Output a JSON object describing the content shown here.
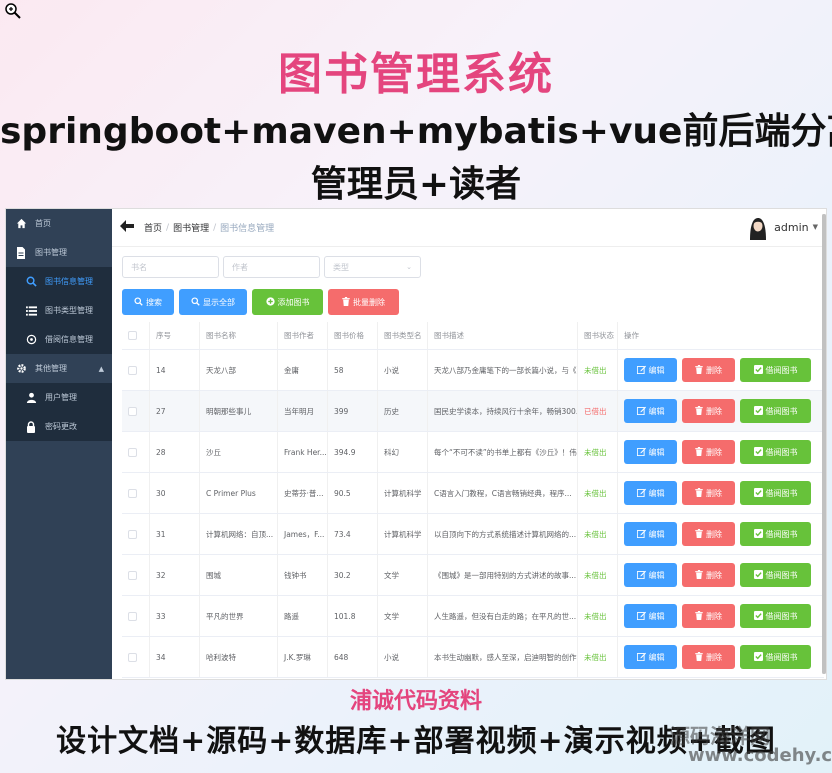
{
  "banner": {
    "title": "图书管理系统",
    "tech": "springboot+maven+mybatis+vue前后端分离",
    "roles": "管理员+读者"
  },
  "sidebar": {
    "items": [
      {
        "label": "首页",
        "icon": "home-icon"
      },
      {
        "label": "图书管理",
        "icon": "document-icon"
      },
      {
        "label": "图书信息管理",
        "icon": "search-icon"
      },
      {
        "label": "图书类型管理",
        "icon": "list-icon"
      },
      {
        "label": "借阅信息管理",
        "icon": "info-icon"
      },
      {
        "label": "其他管理",
        "icon": "gear-icon"
      },
      {
        "label": "用户管理",
        "icon": "user-icon"
      },
      {
        "label": "密码更改",
        "icon": "lock-icon"
      }
    ]
  },
  "header": {
    "breadcrumb": [
      "首页",
      "图书管理",
      "图书信息管理"
    ],
    "user": "admin"
  },
  "filters": {
    "name_placeholder": "书名",
    "author_placeholder": "作者",
    "type_placeholder": "类型"
  },
  "actions": {
    "search": "搜索",
    "show_all": "显示全部",
    "add": "添加图书",
    "batch_delete": "批量删除"
  },
  "table": {
    "headers": [
      "序号",
      "图书名称",
      "图书作者",
      "图书价格",
      "图书类型名",
      "图书描述",
      "图书状态",
      "操作"
    ],
    "rows": [
      {
        "id": "14",
        "name": "天龙八部",
        "author": "金庸",
        "price": "58",
        "type": "小说",
        "desc": "天龙八部乃金庸笔下的一部长篇小说，与《...",
        "status": "未借出",
        "status_kind": "in"
      },
      {
        "id": "27",
        "name": "明朝那些事儿",
        "author": "当年明月",
        "price": "399",
        "type": "历史",
        "desc": "国民史学读本，持续风行十余年，畅销300...",
        "status": "已借出",
        "status_kind": "out"
      },
      {
        "id": "28",
        "name": "沙丘",
        "author": "Frank Her...",
        "price": "394.9",
        "type": "科幻",
        "desc": "每个“不可不读”的书单上都有《沙丘》！伟...",
        "status": "未借出",
        "status_kind": "in"
      },
      {
        "id": "30",
        "name": "C Primer Plus",
        "author": "史蒂芬·普...",
        "price": "90.5",
        "type": "计算机科学",
        "desc": "C语言入门教程，C语言畅销经典，程序...",
        "status": "未借出",
        "status_kind": "in"
      },
      {
        "id": "31",
        "name": "计算机网络：自顶...",
        "author": "James，F...",
        "price": "73.4",
        "type": "计算机科学",
        "desc": "以自顶向下的方式系统描述计算机网络的...",
        "status": "未借出",
        "status_kind": "in"
      },
      {
        "id": "32",
        "name": "围城",
        "author": "钱钟书",
        "price": "30.2",
        "type": "文学",
        "desc": "《围城》是一部用特别的方式讲述的故事...",
        "status": "未借出",
        "status_kind": "in"
      },
      {
        "id": "33",
        "name": "平凡的世界",
        "author": "路遥",
        "price": "101.8",
        "type": "文学",
        "desc": "人生路遥，但没有白走的路；在平凡的世...",
        "status": "未借出",
        "status_kind": "in"
      },
      {
        "id": "34",
        "name": "哈利波特",
        "author": "J.K.罗琳",
        "price": "648",
        "type": "小说",
        "desc": "本书生动幽默，感人至深，启迪明智的创作...",
        "status": "未借出",
        "status_kind": "in"
      }
    ],
    "op_edit": "编辑",
    "op_delete": "删除",
    "op_borrow": "借阅图书"
  },
  "footer": {
    "title": "浦诚代码资料",
    "list": "设计文档+源码+数据库+部署视频+演示视频+截图",
    "watermark1": "源码海洋网",
    "watermark2": "www.codehy.com"
  },
  "colors": {
    "accent_pink": "#e4457e",
    "sidebar_bg": "#304156",
    "primary": "#409eff",
    "success": "#67c23a",
    "danger": "#f56c6c"
  }
}
